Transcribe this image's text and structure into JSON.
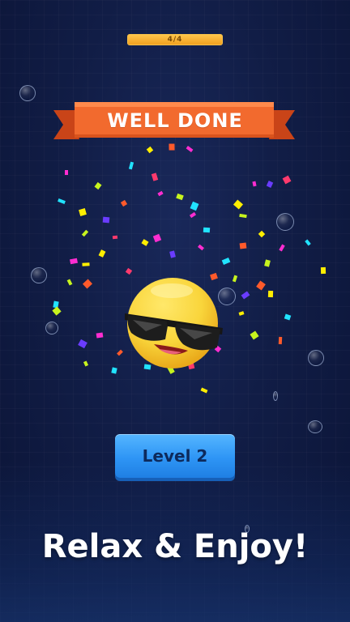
{
  "progress": {
    "label": "4/4",
    "value": 1.0,
    "color": "#f2a51e"
  },
  "banner": {
    "title": "WELL DONE",
    "color": "#f26a2e",
    "shadow_color": "#c94418"
  },
  "emoji": {
    "type": "cool-sunglasses-face",
    "face_color": "#f9d53b"
  },
  "level_button": {
    "label": "Level 2",
    "color": "#2e95f5"
  },
  "tagline": "Relax & Enjoy!",
  "confetti_colors": [
    "#ff2dd1",
    "#c7f41e",
    "#ffee00",
    "#21e3ff",
    "#ff5a2b",
    "#6a3cff",
    "#ff3a6d"
  ],
  "background_color": "#111d46"
}
